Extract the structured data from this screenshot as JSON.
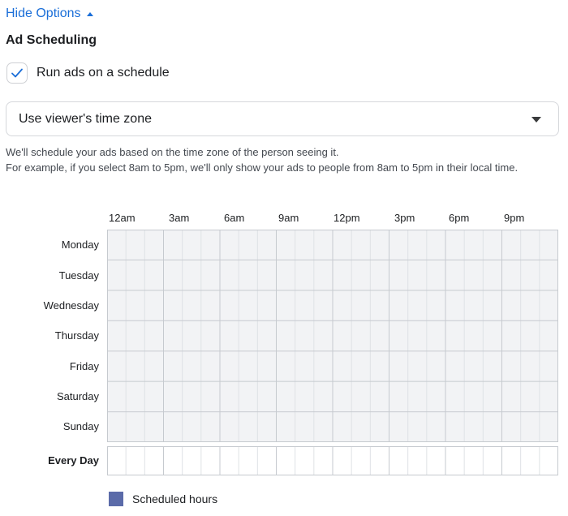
{
  "toggle": {
    "label": "Hide Options"
  },
  "section": {
    "title": "Ad Scheduling"
  },
  "schedule_checkbox": {
    "label": "Run ads on a schedule",
    "checked": true
  },
  "timezone_select": {
    "value": "Use viewer's time zone"
  },
  "help_text": {
    "line1": "We'll schedule your ads based on the time zone of the person seeing it.",
    "line2": "For example, if you select 8am to 5pm, we'll only show your ads to people from 8am to 5pm in their local time."
  },
  "time_labels": [
    "12am",
    "3am",
    "6am",
    "9am",
    "12pm",
    "3pm",
    "6pm",
    "9pm"
  ],
  "days": [
    "Monday",
    "Tuesday",
    "Wednesday",
    "Thursday",
    "Friday",
    "Saturday",
    "Sunday"
  ],
  "every_day_label": "Every Day",
  "legend": {
    "label": "Scheduled hours",
    "color": "#5b6ba9"
  },
  "colors": {
    "cell_fill": "#f2f3f5",
    "minor_line": "#dfe2e6",
    "major_line": "#c6cacf",
    "link": "#1a6ed8"
  }
}
